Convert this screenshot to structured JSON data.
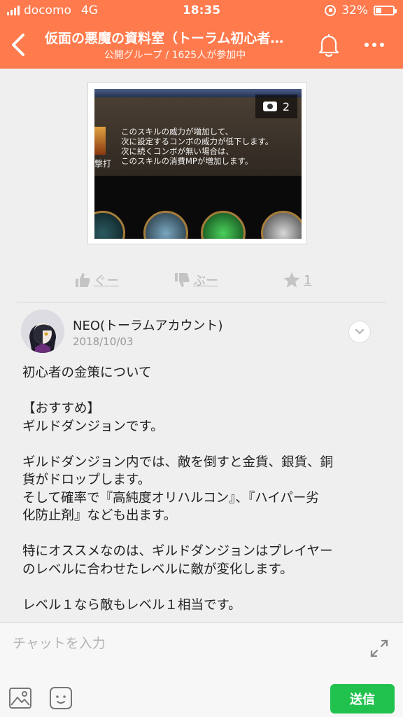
{
  "status_bar": {
    "carrier": "docomo",
    "network": "4G",
    "time": "18:35",
    "battery": "32%",
    "battery_level": 0.32
  },
  "header": {
    "title": "仮面の悪魔の資料室（トーラム初心者…",
    "subtitle": "公開グループ / 1625人が参加中"
  },
  "image": {
    "count": "2",
    "text_lines": [
      "このスキルの威力が増加して、",
      "次に設定するコンボの威力が低下します。",
      "次に続くコンボが無い場合は、",
      "このスキルの消費MPが増加します。"
    ],
    "side_label": "撃打"
  },
  "reactions": {
    "good_label": "ぐー",
    "bad_label": "ぶー",
    "star_count": "1"
  },
  "post": {
    "author": "NEO(トーラムアカウント)",
    "date": "2018/10/03",
    "lines": [
      "初心者の金策について",
      "",
      "【おすすめ】",
      "ギルドダンジョンです。",
      "",
      "ギルドダンジョン内では、敵を倒すと金貨、銀貨、銅",
      "貨がドロップします。",
      "そして確率で『高純度オリハルコン』、『ハイパー劣",
      "化防止剤』なども出ます。",
      "",
      "特にオススメなのは、ギルドダンジョンはプレイヤー",
      "のレベルに合わせたレベルに敵が変化します。",
      "",
      "レベル１なら敵もレベル１相当です。"
    ]
  },
  "composer": {
    "placeholder": "チャットを入力",
    "send_label": "送信"
  },
  "colors": {
    "header": "#ff7a4d",
    "send": "#21c14e"
  }
}
